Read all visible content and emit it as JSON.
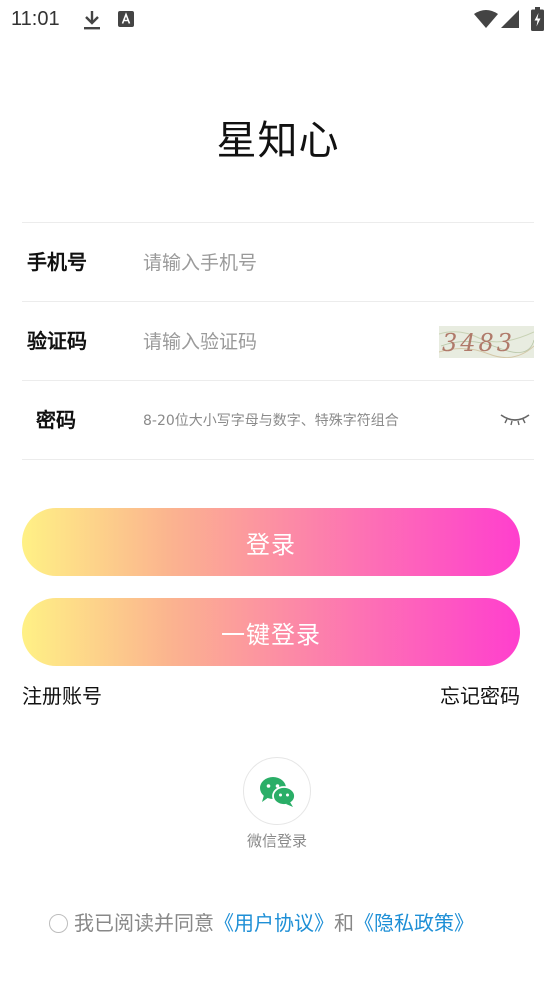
{
  "status_bar": {
    "time": "11:01",
    "left_icons": [
      "download-icon",
      "a-badge-icon"
    ],
    "right_icons": [
      "wifi-icon",
      "signal-icon",
      "battery-icon"
    ]
  },
  "app": {
    "title": "星知心"
  },
  "form": {
    "phone": {
      "label": "手机号",
      "placeholder": "请输入手机号"
    },
    "code": {
      "label": "验证码",
      "placeholder": "请输入验证码",
      "captcha_text": "3483"
    },
    "password": {
      "label": "密码",
      "placeholder": "8-20位大小写字母与数字、特殊字符组合",
      "toggle_icon": "eye-closed-icon"
    }
  },
  "buttons": {
    "login": "登录",
    "one_key_login": "一键登录"
  },
  "links": {
    "register": "注册账号",
    "forgot": "忘记密码"
  },
  "wechat": {
    "icon": "wechat-icon",
    "label": "微信登录"
  },
  "agreement": {
    "prefix": "我已阅读并同意",
    "user_agreement": "《用户协议》",
    "and": "和",
    "privacy_policy": "《隐私政策》"
  },
  "colors": {
    "gradient_start": "#fff185",
    "gradient_end": "#ff3fce",
    "link_blue": "#1e8fd6",
    "wechat_green": "#2aae67"
  }
}
